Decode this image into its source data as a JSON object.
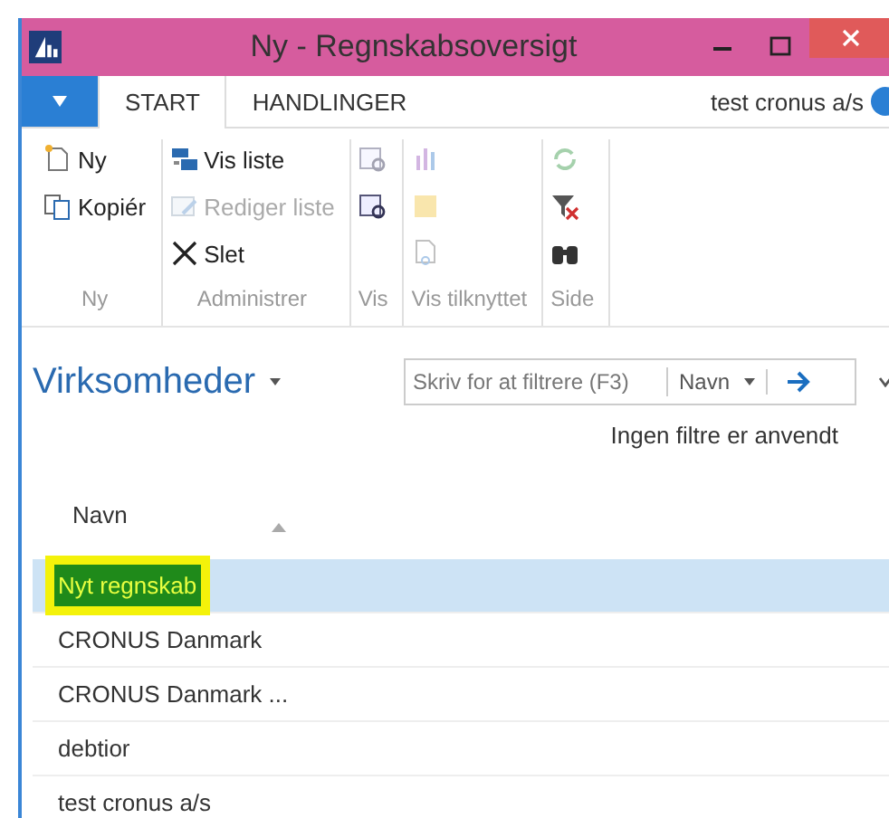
{
  "window": {
    "title": "Ny - Regnskabsoversigt"
  },
  "tabs": [
    {
      "label": "START",
      "selected": true
    },
    {
      "label": "HANDLINGER",
      "selected": false
    }
  ],
  "company": "test cronus a/s",
  "ribbon": [
    {
      "label": "Ny",
      "items": [
        {
          "kind": "new",
          "label": "Ny",
          "disabled": false
        },
        {
          "kind": "copy",
          "label": "Kopiér",
          "disabled": false
        }
      ]
    },
    {
      "label": "Administrer",
      "items": [
        {
          "kind": "list",
          "label": "Vis liste",
          "disabled": false
        },
        {
          "kind": "edit",
          "label": "Rediger liste",
          "disabled": true
        },
        {
          "kind": "delete",
          "label": "Slet",
          "disabled": false
        }
      ]
    },
    {
      "label": "Vis",
      "items": [
        {
          "kind": "view",
          "disabled": true
        },
        {
          "kind": "view",
          "disabled": false
        }
      ]
    },
    {
      "label": "Vis tilknyttet",
      "items": [
        {
          "kind": "chart",
          "disabled": true
        },
        {
          "kind": "note",
          "disabled": true
        },
        {
          "kind": "link",
          "disabled": true
        }
      ]
    },
    {
      "label": "Side",
      "items": [
        {
          "kind": "refresh",
          "disabled": true
        },
        {
          "kind": "clearfilter",
          "disabled": false
        },
        {
          "kind": "find",
          "disabled": false
        }
      ]
    }
  ],
  "list": {
    "title": "Virksomheder",
    "filter": {
      "placeholder": "Skriv for at filtrere (F3)",
      "field": "Navn"
    },
    "filter_status": "Ingen filtre er anvendt",
    "column": "Navn",
    "rows": [
      {
        "name": "Nyt regnskab",
        "selected": true,
        "highlighted": true
      },
      {
        "name": "CRONUS Danmark",
        "selected": false,
        "highlighted": false
      },
      {
        "name": "CRONUS Danmark ...",
        "selected": false,
        "highlighted": false
      },
      {
        "name": "debtior",
        "selected": false,
        "highlighted": false
      },
      {
        "name": "test cronus a/s",
        "selected": false,
        "highlighted": false
      }
    ]
  }
}
